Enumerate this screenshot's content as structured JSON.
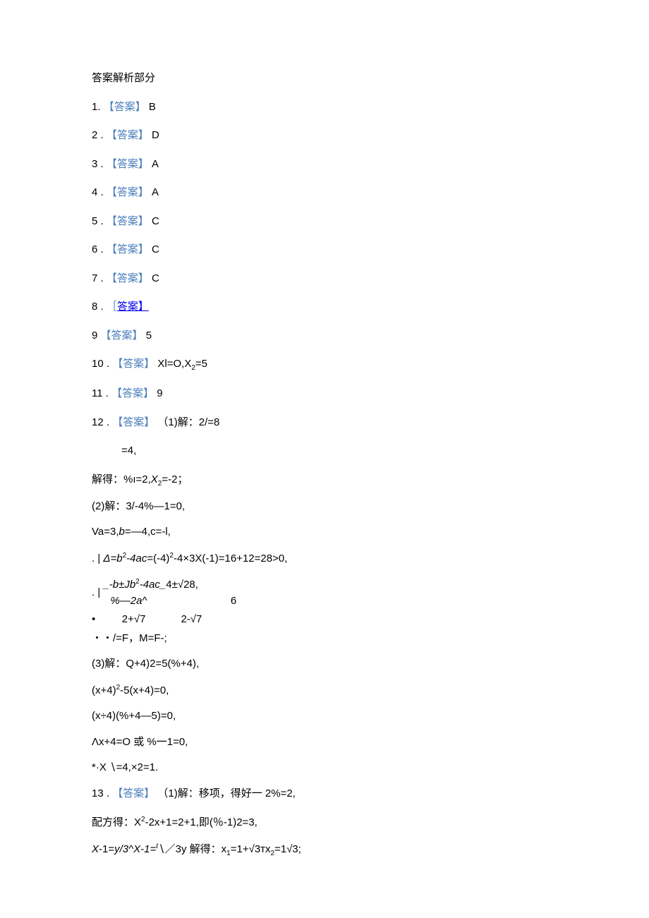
{
  "heading": "答案解析部分",
  "answers": {
    "a1_num": "1.",
    "a1_label": "【答案】",
    "a1_val": "B",
    "a2_num": "2   .",
    "a2_label": "【答案】",
    "a2_val": "D",
    "a3_num": "3   .",
    "a3_label": "【答案】",
    "a3_val": "A",
    "a4_num": "4   .",
    "a4_label": "【答案】",
    "a4_val": "A",
    "a5_num": "5   .",
    "a5_label": "【答案】",
    "a5_val": "C",
    "a6_num": "6   .",
    "a6_label": "【答案】",
    "a6_val": "C",
    "a7_num": "7   .",
    "a7_label": "【答案】",
    "a7_val": "C",
    "a8_num": "8   . ",
    "a8_label_open": "［",
    "a8_label_rest": "答案】",
    "a9_num": "9",
    "a9_label": "【答案】",
    "a9_val": "5",
    "a10_num": "10   .",
    "a10_label": "【答案】",
    "a10_val_pre": "Xl=O,X",
    "a10_sub": "2",
    "a10_val_post": "=5",
    "a11_num": "11   .",
    "a11_label": "【答案】",
    "a11_val": "9",
    "a12_num": "12   .",
    "a12_label": "【答案】",
    "a12_val": "（1)解：2/=8",
    "a12_line2": "=4,",
    "a12_l3a": "解得：%ı=2,",
    "a12_l3b": "X",
    "a12_l3sub": "2",
    "a12_l3c": "=-2；",
    "a12_p2": "(2)解：3/-4%—1=0,",
    "a12_p2b": "Va=3,",
    "a12_p2b_i": "b",
    "a12_p2b2": "=—4,c=-l,",
    "a12_delta_a": ". |",
    "a12_delta_b": "Δ=b",
    "a12_delta_sup": "2",
    "a12_delta_c": "-4ac",
    "a12_delta_d": "=(-4)",
    "a12_delta_sup2": "2",
    "a12_delta_e": "-4×3X(-1)=16+12=28>0,",
    "a12_frac_lead": ". |",
    "a12_frac_top": "_-b±Jb",
    "a12_frac_top_sup": "2",
    "a12_frac_top2": "-4ac_",
    "a12_frac_top3": "4±√28",
    "a12_frac_bot": "%—2a^",
    "a12_frac_bot2": "6",
    "a12_dot1": "•         2+√7            2-√7",
    "a12_dot2": "・・/=F，M=F-;",
    "a12_p3": "(3)解：Q+4)2=5(%+4),",
    "a12_p3b_a": "(x+4)",
    "a12_p3b_sup": "2",
    "a12_p3b_b": "-5(x+4)=0,",
    "a12_p3c": "(x÷4)(%+4—5)=0,",
    "a12_p3d": "Λx+4=O 或 %一1=0,",
    "a12_p3e_a": "*·X",
    "a12_p3e_b": "∖=4,×2=1.",
    "a13_num": "13   .",
    "a13_label": "【答案】",
    "a13_val": "（1)解：移项，得好一 2%=2,",
    "a13_b_a": "配方得：X",
    "a13_b_sup": "2",
    "a13_b_b": "-2x+1=2+1,即(％-1)2=3,",
    "a13_c_a": "X",
    "a13_c_b": "-1=",
    "a13_c_c": "y/3^X-1=",
    "a13_c_sup": "t",
    "a13_c_d": "∖／3y",
    "a13_c_e": "解得：x",
    "a13_c_sub1": "1",
    "a13_c_f": "=1+√3тx",
    "a13_c_sub2": "2",
    "a13_c_g": "=1√3;"
  }
}
